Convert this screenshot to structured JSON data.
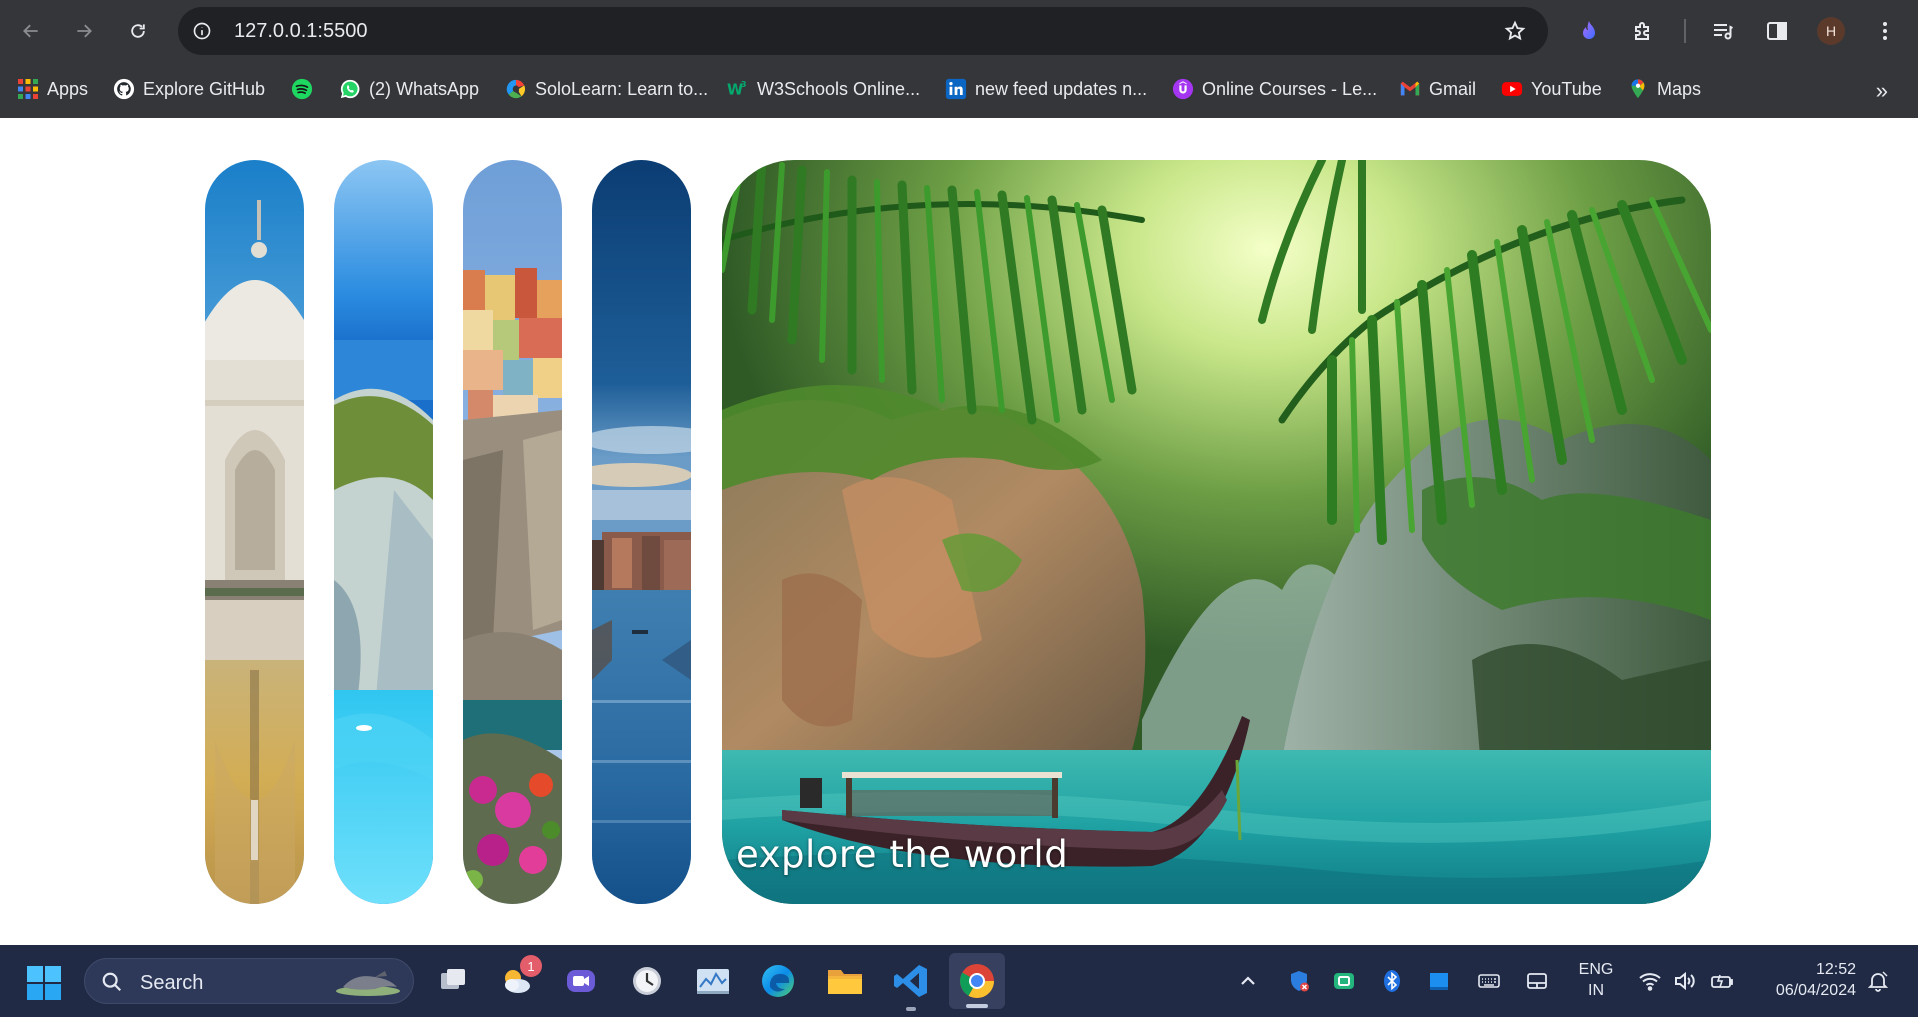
{
  "browser": {
    "url": "127.0.0.1:5500",
    "profile_initial": "H",
    "icons": [
      "back-arrow-icon",
      "forward-arrow-icon",
      "reload-icon",
      "site-info-icon",
      "bookmark-star-icon",
      "extension-flame-icon",
      "extensions-puzzle-icon",
      "media-control-icon",
      "side-panel-icon",
      "kebab-menu-icon"
    ]
  },
  "bookmarks": {
    "items": [
      {
        "label": "Apps",
        "icon": "apps-grid-icon"
      },
      {
        "label": "Explore GitHub",
        "icon": "github-icon"
      },
      {
        "label": "",
        "icon": "spotify-icon"
      },
      {
        "label": "(2) WhatsApp",
        "icon": "whatsapp-icon"
      },
      {
        "label": "SoloLearn: Learn to...",
        "icon": "sololearn-icon"
      },
      {
        "label": "W3Schools Online...",
        "icon": "w3schools-icon"
      },
      {
        "label": "new feed updates n...",
        "icon": "linkedin-icon"
      },
      {
        "label": "Online Courses - Le...",
        "icon": "udemy-icon"
      },
      {
        "label": "Gmail",
        "icon": "gmail-icon"
      },
      {
        "label": "YouTube",
        "icon": "youtube-icon"
      },
      {
        "label": "Maps",
        "icon": "maps-icon"
      }
    ],
    "more": "»"
  },
  "gallery": {
    "panels": [
      {
        "subject": "Taj Mahal"
      },
      {
        "subject": "turquoise beach cove"
      },
      {
        "subject": "cliffside village with flowers"
      },
      {
        "subject": "Venice canal"
      },
      {
        "subject": "tropical lagoon with longtail boat"
      }
    ],
    "caption": "explore the world"
  },
  "taskbar": {
    "search_label": "Search",
    "apps": [
      "task-view-icon",
      "weather-widget-icon",
      "meet-camera-icon",
      "clock-app-icon",
      "photos-chart-icon",
      "edge-browser-icon",
      "file-explorer-icon",
      "vscode-icon",
      "chrome-icon"
    ],
    "notification_badge": "1",
    "tray": [
      "chevron-up-icon",
      "defender-icon",
      "phone-link-icon",
      "bluetooth-icon",
      "app-tray-icon",
      "keyboard-icon",
      "touchpad-icon",
      "wifi-icon",
      "volume-icon",
      "battery-icon",
      "notification-bell-icon"
    ],
    "lang_line1": "ENG",
    "lang_line2": "IN",
    "time": "12:52",
    "date": "06/04/2024"
  }
}
